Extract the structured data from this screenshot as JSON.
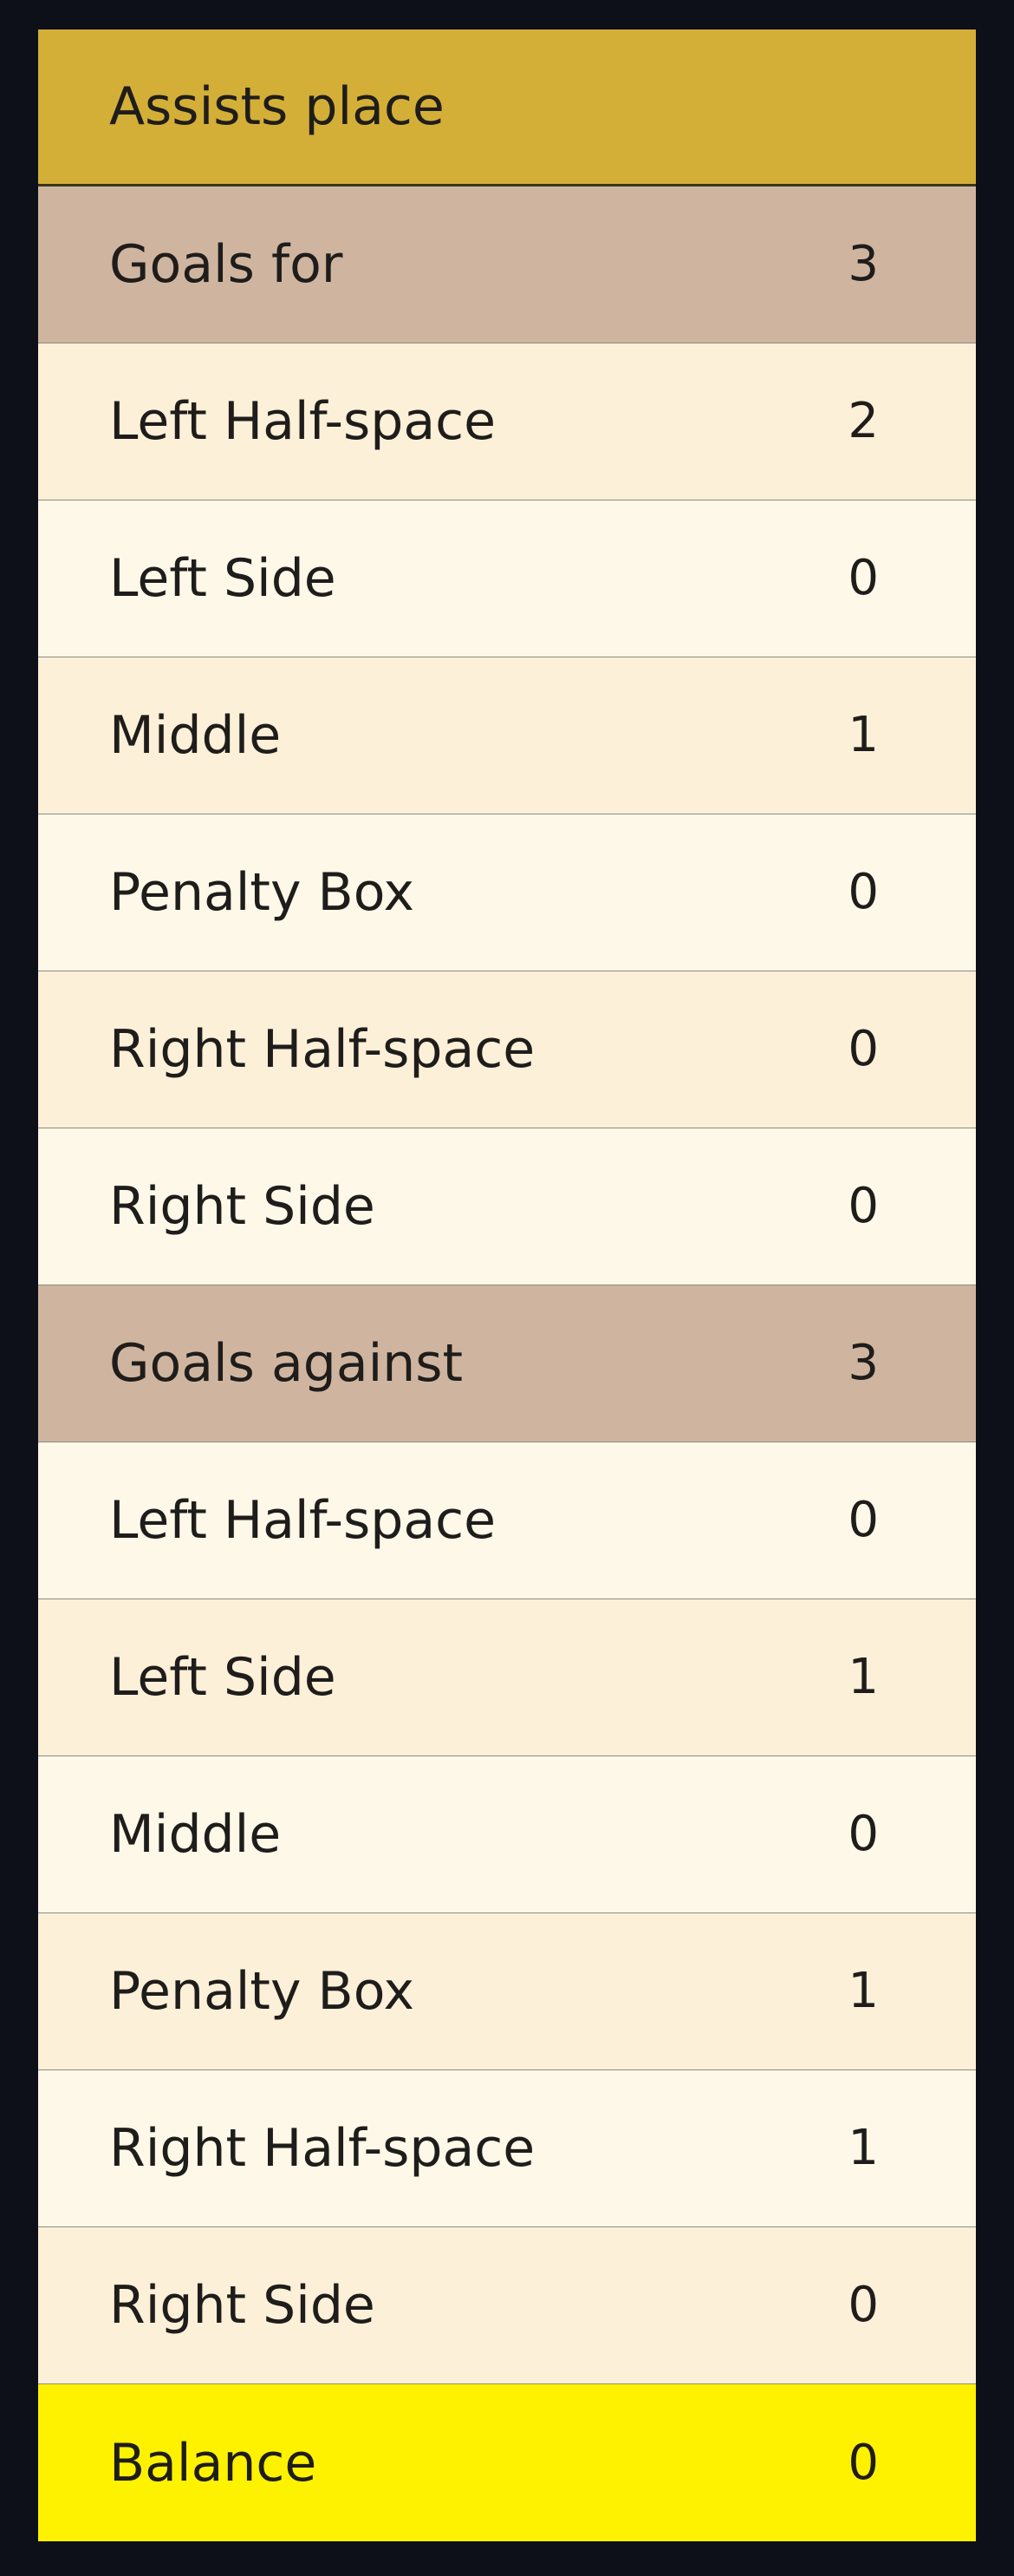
{
  "title": "Assists place",
  "sections": [
    {
      "label": "Goals for",
      "value": "3",
      "items": [
        {
          "label": "Left Half-space",
          "value": "2"
        },
        {
          "label": "Left Side",
          "value": "0"
        },
        {
          "label": "Middle",
          "value": "1"
        },
        {
          "label": "Penalty Box",
          "value": "0"
        },
        {
          "label": "Right Half-space",
          "value": "0"
        },
        {
          "label": "Right Side",
          "value": "0"
        }
      ]
    },
    {
      "label": "Goals against",
      "value": "3",
      "items": [
        {
          "label": "Left Half-space",
          "value": "0"
        },
        {
          "label": "Left Side",
          "value": "1"
        },
        {
          "label": "Middle",
          "value": "0"
        },
        {
          "label": "Penalty Box",
          "value": "1"
        },
        {
          "label": "Right Half-space",
          "value": "1"
        },
        {
          "label": "Right Side",
          "value": "0"
        }
      ]
    }
  ],
  "balance": {
    "label": "Balance",
    "value": "0"
  },
  "colors": {
    "background": "#0d1019",
    "title": "#d4af37",
    "section": "#cfb59f",
    "row_odd": "#fdf0d8",
    "row_even": "#fdf8e8",
    "balance": "#fff200"
  }
}
